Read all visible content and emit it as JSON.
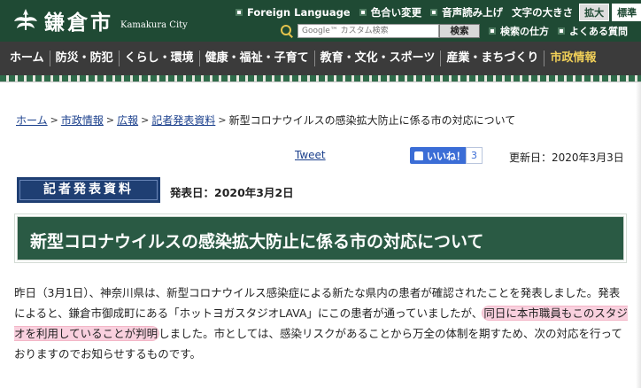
{
  "header": {
    "site_name": "鎌倉市",
    "site_name_en": "Kamakura City",
    "utility": {
      "foreign_language": "Foreign Language",
      "color_change": "色合い変更",
      "voice_reading": "音声読み上げ",
      "font_size_label": "文字の大きさ",
      "font_size_large": "拡大",
      "font_size_standard": "標準"
    },
    "search": {
      "placeholder": "Google™ カスタム検索",
      "button": "検索",
      "how_to_search": "検索の仕方",
      "faq": "よくある質問"
    }
  },
  "nav": {
    "items": [
      "ホーム",
      "防災・防犯",
      "くらし・環境",
      "健康・福祉・子育て",
      "教育・文化・スポーツ",
      "産業・まちづくり",
      "市政情報"
    ]
  },
  "breadcrumb": {
    "items": [
      "ホーム",
      "市政情報",
      "広報",
      "記者発表資料"
    ],
    "current": "新型コロナウイルスの感染拡大防止に係る市の対応について"
  },
  "share": {
    "tweet": "Tweet",
    "like_label": "いいね！",
    "like_count": "3"
  },
  "updated_date": "更新日：2020年3月3日",
  "press_badge": "記者発表資料",
  "release_date": "発表日：2020年3月2日",
  "page_title": "新型コロナウイルスの感染拡大防止に係る市の対応について",
  "body": {
    "part1": "昨日（3月1日）、神奈川県は、新型コロナウイルス感染症による新たな県内の患者が確認されたことを発表しました。発表によると、鎌倉市御成町にある「ホットヨガスタジオLAVA」にこの患者が通っていましたが、",
    "highlight": "同日に本市職員もこのスタジオを利用していることが判明",
    "part2": "しました。市としては、感染リスクがあることから万全の体制を期すため、次の対応を行っておりますのでお知らせするものです。"
  },
  "colors": {
    "header_bg": "#1f4a34",
    "nav_bg": "#3b3b3b",
    "nav_active": "#f0cf58",
    "title_bar_bg": "#2a5a44",
    "press_badge_bg": "#1f3f73",
    "highlight": "#f8c8d8",
    "link": "#1a3f8c"
  }
}
